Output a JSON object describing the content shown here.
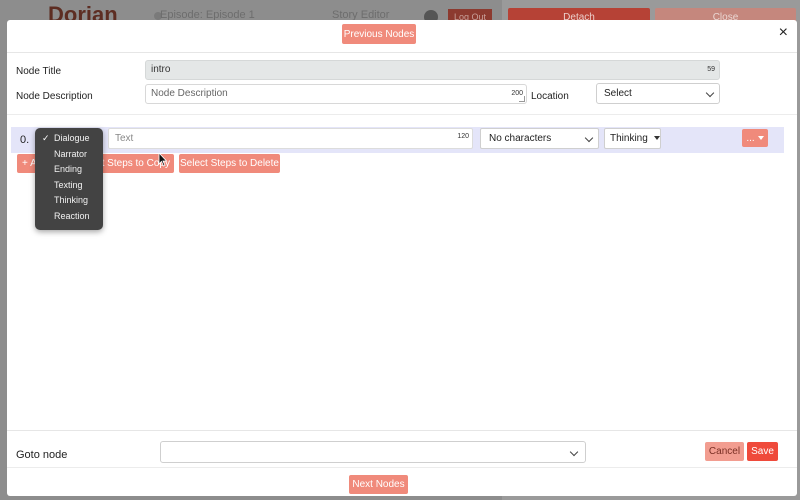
{
  "background": {
    "app_title": "Dorian",
    "breadcrumb": "Episode: Episode 1",
    "middle_text": "Story Editor",
    "logout_label": "Log Out",
    "detach_label": "Detach",
    "close_label": "Close"
  },
  "modal": {
    "close_icon": "×",
    "previous_nodes_label": "Previous Nodes",
    "next_nodes_label": "Next Nodes",
    "node_title_label": "Node Title",
    "node_title_value": "intro",
    "node_title_counter": "59",
    "node_description_label": "Node Description",
    "node_description_placeholder": "Node Description",
    "node_description_counter": "200",
    "location_label": "Location",
    "location_value": "Select",
    "step": {
      "number": "0.",
      "text_placeholder": "Text",
      "text_counter": "120",
      "characters_value": "No characters",
      "thinking_label": "Thinking",
      "more_label": "..."
    },
    "add_label": "+ A",
    "select_copy_label": "ct Steps to Copy",
    "select_delete_label": "Select Steps to Delete",
    "type_menu": {
      "items": [
        "Dialogue",
        "Narrator",
        "Ending",
        "Texting",
        "Thinking",
        "Reaction"
      ],
      "checkmark": "✓",
      "selected": "Dialogue"
    },
    "goto_label": "Goto node",
    "goto_value": "",
    "cancel_label": "Cancel",
    "save_label": "Save"
  },
  "colors": {
    "accent": "#f08a7b",
    "save": "#ef4a3b",
    "step_row": "#e4e5f9",
    "menu_bg": "#434343"
  }
}
